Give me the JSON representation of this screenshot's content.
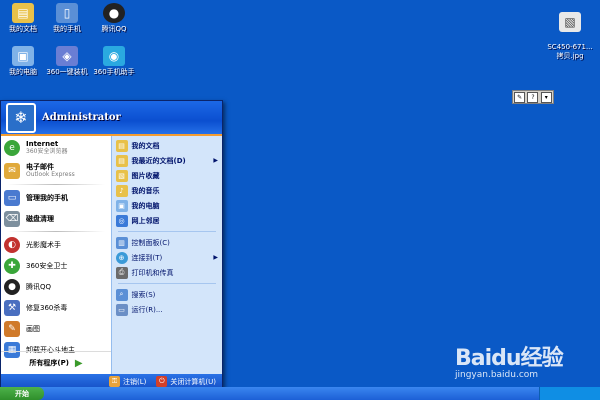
{
  "desktop": {
    "icons": [
      {
        "label": "我的文档",
        "icon": "documents-folder-icon",
        "color": "#e8c14a"
      },
      {
        "label": "我的手机",
        "icon": "phone-icon",
        "color": "#5a8fd6"
      },
      {
        "label": "腾讯QQ",
        "icon": "qq-penguin-icon",
        "color": "#222222"
      },
      {
        "label": "我的电脑",
        "icon": "computer-icon",
        "color": "#7fb2e8"
      },
      {
        "label": "360一键装机",
        "icon": "installer-icon",
        "color": "#6a7ed4"
      },
      {
        "label": "360手机助手",
        "icon": "phone-assistant-icon",
        "color": "#2aa9e0"
      },
      {
        "label": "SC450-671...\n拷贝.jpg",
        "icon": "image-file-icon",
        "color": "#e8e8e8"
      }
    ]
  },
  "start_menu": {
    "user_name": "Administrator",
    "pinned": [
      {
        "title": "Internet",
        "subtitle": "360安全浏览器",
        "icon": "browser-icon",
        "color": "#3aa63a"
      },
      {
        "title": "电子邮件",
        "subtitle": "Outlook Express",
        "icon": "email-icon",
        "color": "#e0a93a"
      }
    ],
    "recent": [
      {
        "label": "管理我的手机",
        "icon": "phone-manager-icon",
        "color": "#4a7ad0"
      },
      {
        "label": "磁盘清理",
        "icon": "disk-cleanup-icon",
        "color": "#7d8f9d"
      },
      {
        "label": "光影魔术手",
        "icon": "photo-editor-icon",
        "color": "#c2322f"
      },
      {
        "label": "360安全卫士",
        "icon": "security-guard-icon",
        "color": "#3aa63a"
      },
      {
        "label": "腾讯QQ",
        "icon": "qq-penguin-icon",
        "color": "#222222"
      },
      {
        "label": "修复360杀毒",
        "icon": "antivirus-repair-icon",
        "color": "#4a6fc0"
      },
      {
        "label": "画图",
        "icon": "paint-icon",
        "color": "#d07a2a"
      },
      {
        "label": "卸载开心斗地主",
        "icon": "uninstall-game-icon",
        "color": "#3a7ad8"
      }
    ],
    "all_programs": "所有程序(P)",
    "right": [
      {
        "label": "我的文档",
        "icon": "documents-folder-icon",
        "color": "#e8c14a",
        "bold": true
      },
      {
        "label": "我最近的文档(D)",
        "icon": "recent-docs-icon",
        "color": "#e8c14a",
        "bold": true,
        "submenu": true
      },
      {
        "label": "图片收藏",
        "icon": "pictures-folder-icon",
        "color": "#e8c14a",
        "bold": true
      },
      {
        "label": "我的音乐",
        "icon": "music-folder-icon",
        "color": "#e8c14a",
        "bold": true
      },
      {
        "label": "我的电脑",
        "icon": "computer-icon",
        "color": "#7fb2e8",
        "bold": true
      },
      {
        "label": "网上邻居",
        "icon": "network-icon",
        "color": "#3a7ad8",
        "bold": true
      },
      {
        "label": "控制面板(C)",
        "icon": "control-panel-icon",
        "color": "#5a8fd6",
        "bold": false
      },
      {
        "label": "连接到(T)",
        "icon": "connect-icon",
        "color": "#3a9ad8",
        "bold": false,
        "submenu": true
      },
      {
        "label": "打印机和传真",
        "icon": "printer-icon",
        "color": "#6b6b6b",
        "bold": false
      },
      {
        "label": "搜索(S)",
        "icon": "search-icon",
        "color": "#5a8fd6",
        "bold": false
      },
      {
        "label": "运行(R)...",
        "icon": "run-icon",
        "color": "#6b8fc6",
        "bold": false
      }
    ],
    "logoff": "注销(L)",
    "shutdown": "关闭计算机(U)"
  },
  "taskbar": {
    "start_label": "开始"
  },
  "watermark": {
    "logo": "Baidu经验",
    "url": "jingyan.baidu.com"
  }
}
